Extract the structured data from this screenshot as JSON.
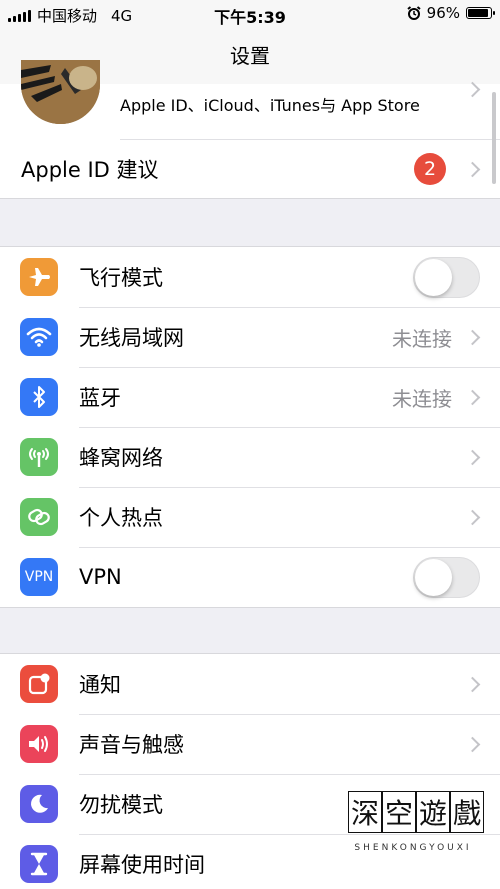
{
  "status_bar": {
    "carrier": "中国移动",
    "network": "4G",
    "time": "下午5:39",
    "battery": "96%",
    "battery_level": 0.96
  },
  "nav": {
    "title": "设置"
  },
  "account": {
    "subtitle": "Apple ID、iCloud、iTunes与 App Store",
    "suggestion_label": "Apple ID 建议",
    "suggestion_badge": "2"
  },
  "connectivity": {
    "airplane": {
      "label": "飞行模式",
      "icon": "airplane-icon",
      "color": "#f09a37",
      "on": false
    },
    "wifi": {
      "label": "无线局域网",
      "value": "未连接",
      "icon": "wifi-icon",
      "color": "#3478f6"
    },
    "bluetooth": {
      "label": "蓝牙",
      "value": "未连接",
      "icon": "bluetooth-icon",
      "color": "#3478f6"
    },
    "cellular": {
      "label": "蜂窝网络",
      "icon": "cellular-antenna-icon",
      "color": "#65c466"
    },
    "hotspot": {
      "label": "个人热点",
      "icon": "hotspot-chain-icon",
      "color": "#65c466"
    },
    "vpn": {
      "label": "VPN",
      "badge_text": "VPN",
      "icon": "vpn-icon",
      "color": "#3478f6",
      "on": false
    }
  },
  "system": {
    "notifications": {
      "label": "通知",
      "icon": "notifications-icon",
      "color": "#eb4d3d"
    },
    "sounds": {
      "label": "声音与触感",
      "icon": "speaker-icon",
      "color": "#eb445a"
    },
    "dnd": {
      "label": "勿扰模式",
      "icon": "moon-icon",
      "color": "#5e5ce6"
    },
    "screen_time": {
      "label": "屏幕使用时间",
      "icon": "hourglass-icon",
      "color": "#5e5ce6"
    }
  },
  "watermark": {
    "chars": [
      "深",
      "空",
      "遊",
      "戲"
    ],
    "subtitle": "SHENKONGYOUXI"
  }
}
